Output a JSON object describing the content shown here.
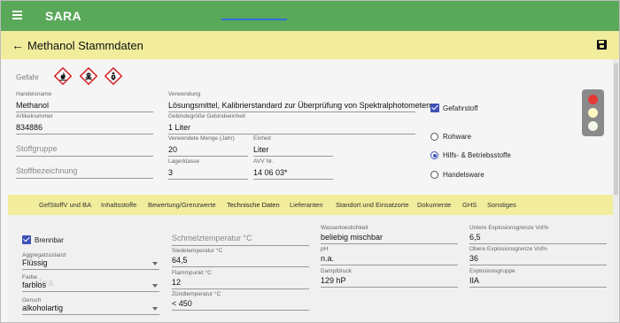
{
  "app": {
    "title": "SARA"
  },
  "header": {
    "title": "Methanol Stammdaten"
  },
  "hazard": {
    "label": "Gefahr",
    "pictograms": [
      "flame",
      "skull",
      "health-hazard"
    ],
    "colors": {
      "border": "#d32f2f",
      "symbol": "#111111"
    }
  },
  "fields": {
    "handelsname": {
      "label": "Handelsname",
      "value": "Methanol"
    },
    "artikelnummer": {
      "label": "Artikelnummer",
      "value": "834886"
    },
    "stoffgruppe": {
      "placeholder": "Stoffgruppe"
    },
    "stoffbezeichnung": {
      "placeholder": "Stoffbezeichnung"
    },
    "verwendung": {
      "label": "Verwendung",
      "value": "Lösungsmittel, Kalibrierstandard zur Überprüfung von Spektralphotometern"
    },
    "gebindegroesse": {
      "label": "Gebindegröße Gebindeeinheit",
      "value": "1 Liter"
    },
    "verwendete_menge": {
      "label": "Verwendete Menge (Jahr)",
      "value": "20"
    },
    "einheit": {
      "label": "Einheit",
      "value": "Liter"
    },
    "lagerklasse": {
      "label": "Lagerklasse",
      "value": "3"
    },
    "avv": {
      "label": "AVV Nr.",
      "value": "14 06 03*"
    }
  },
  "gefahrstoff": {
    "label": "Gefahrstoff",
    "checked": true
  },
  "warentyp": {
    "options": [
      "Rohware",
      "Hilfs- & Betriebsstoffe",
      "Handelsware"
    ],
    "selected": "Hilfs- & Betriebsstoffe"
  },
  "traffic_light": {
    "red": "#e53935",
    "yellow": "#fff9c4",
    "green": "#f1f8e9",
    "active": "red"
  },
  "tabs": [
    "GefStoffV und BA",
    "Inhaltsstoffe",
    "Bewertung/Grenzwerte",
    "Technische Daten",
    "Lieferanten",
    "Standort und Einsatzorte",
    "Dokumente",
    "GHS",
    "Sonstiges"
  ],
  "active_tab": "Technische Daten",
  "tech": {
    "brennbar": {
      "label": "Brennbar",
      "checked": true
    },
    "aggregatzustand": {
      "label": "Aggregatzustand",
      "value": "Flüssig"
    },
    "farbe": {
      "label": "Farbe",
      "value": "farblos"
    },
    "geruch": {
      "label": "Geruch",
      "value": "alkoholartig"
    },
    "schmelztemperatur": {
      "placeholder": "Schmelztemperatur °C"
    },
    "siedetemperatur": {
      "label": "Siedetemperatur °C",
      "value": "64,5"
    },
    "flammpunkt": {
      "label": "Flammpunkt °C",
      "value": "12"
    },
    "zuendtemperatur": {
      "label": "Zündtemperatur °C",
      "value": "< 450"
    },
    "wasserloeslichkeit": {
      "label": "Wasserloeslichkeit",
      "value": "beliebig mischbar"
    },
    "ph": {
      "label": "pH",
      "value": "n.a."
    },
    "dampfdruck": {
      "label": "Dampfdruck",
      "value": "129 hP"
    },
    "untere_ex": {
      "label": "Untere Explosionsgrenze Vol%",
      "value": "6,5"
    },
    "obere_ex": {
      "label": "Obere Explosionsgrenze Vol%",
      "value": "36"
    },
    "explosionsgruppe": {
      "label": "Explosionsgruppe",
      "value": "IIA"
    }
  },
  "colors": {
    "appbar": "#5aa85a",
    "pagebar": "#f1ed9c",
    "accent": "#3f51b5",
    "tab_underline": "#2c6fd6"
  }
}
